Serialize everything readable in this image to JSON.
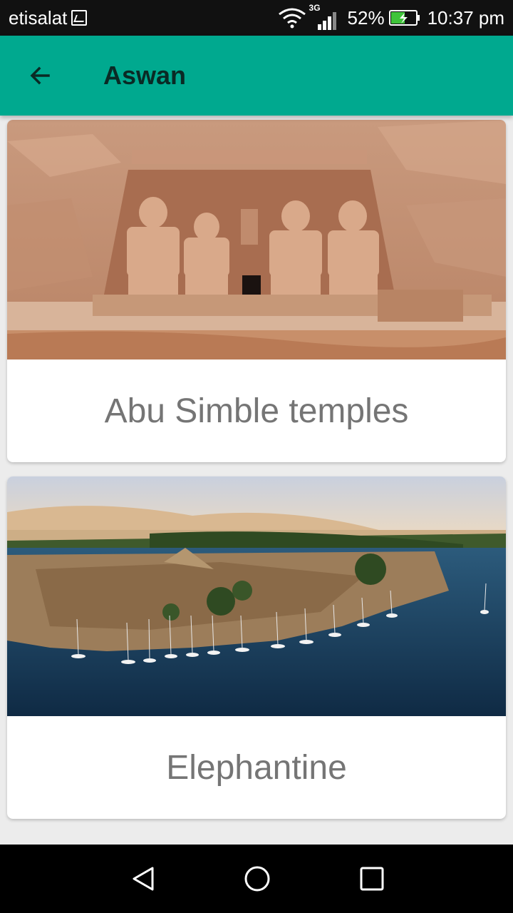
{
  "status_bar": {
    "carrier": "etisalat",
    "network_type": "3G",
    "battery": "52%",
    "time": "10:37 pm",
    "icons": [
      "image-notification-icon",
      "wifi-icon",
      "signal-icon",
      "battery-charging-icon"
    ]
  },
  "app_bar": {
    "title": "Aswan",
    "back_icon": "arrow-left-icon",
    "background_color": "#00a98f"
  },
  "places": [
    {
      "label": "Abu Simble temples",
      "image": "abu-simbel-temple-photo"
    },
    {
      "label": "Elephantine",
      "image": "elephantine-island-photo"
    }
  ],
  "nav_bar": {
    "icons": [
      "back-triangle-icon",
      "home-circle-icon",
      "recents-square-icon"
    ]
  }
}
